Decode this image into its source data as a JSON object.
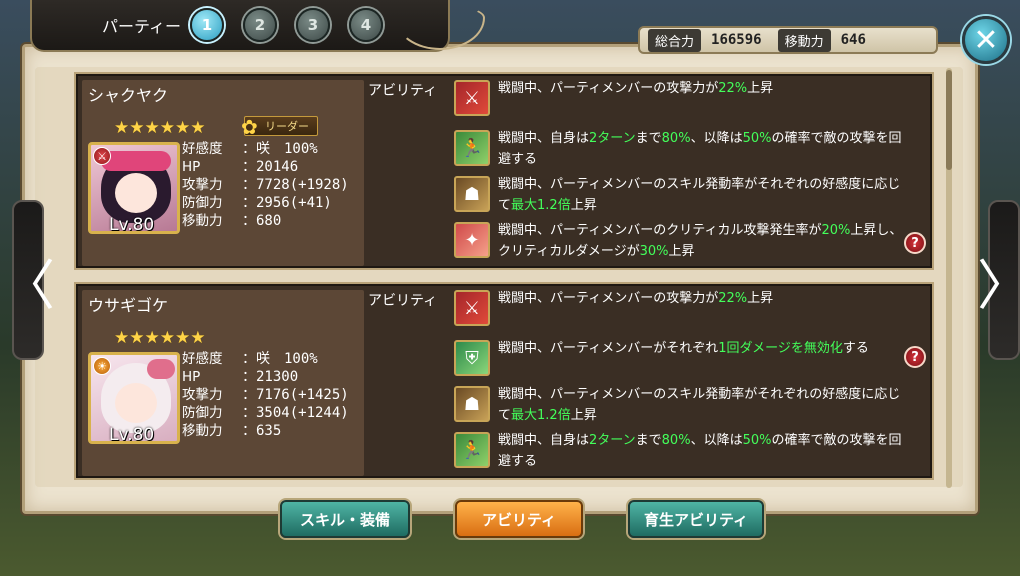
{
  "header": {
    "party_title": "パーティー",
    "party_tabs": [
      {
        "label": "1",
        "active": true
      },
      {
        "label": "2",
        "active": false
      },
      {
        "label": "3",
        "active": false
      },
      {
        "label": "4",
        "active": false
      }
    ],
    "total_power_label": "総合力",
    "total_power_value": "166596",
    "movement_label": "移動力",
    "movement_value": "646",
    "close_icon": "close-icon"
  },
  "nav": {
    "left_arrow": "〈",
    "right_arrow": "〉"
  },
  "ability_heading": "アビリティ",
  "members": [
    {
      "name": "シャクヤク",
      "stars": "★★★★★★",
      "leader_badge": "リーダー",
      "level": "Lv.80",
      "stats": [
        {
          "k": "好感度",
          "v": "：咲　100%"
        },
        {
          "k": "HP",
          "v": "：20146"
        },
        {
          "k": "攻撃力",
          "v": "：7728(+1928)"
        },
        {
          "k": "防御力",
          "v": "：2956(+41)"
        },
        {
          "k": "移動力",
          "v": "：680"
        }
      ],
      "abilities": [
        {
          "icon": "sword-icon",
          "parts": [
            "戦闘中、パーティメンバーの攻撃力が",
            "22%",
            "上昇"
          ]
        },
        {
          "icon": "dodge-icon",
          "parts": [
            "戦闘中、自身は",
            "2ターン",
            "まで",
            "80%",
            "、以降は",
            "50%",
            "の確率で敵の攻撃を回避する"
          ]
        },
        {
          "icon": "skill-icon",
          "parts": [
            "戦闘中、パーティメンバーのスキル発動率がそれぞれの好感度に応じて",
            "最大1.2倍",
            "上昇"
          ]
        },
        {
          "icon": "crit-icon",
          "parts": [
            "戦闘中、パーティメンバーのクリティカル攻撃発生率が",
            "20%",
            "上昇し、クリティカルダメージが",
            "30%",
            "上昇"
          ]
        }
      ]
    },
    {
      "name": "ウサギゴケ",
      "stars": "★★★★★★",
      "level": "Lv.80",
      "stats": [
        {
          "k": "好感度",
          "v": "：咲　100%"
        },
        {
          "k": "HP",
          "v": "：21300"
        },
        {
          "k": "攻撃力",
          "v": "：7176(+1425)"
        },
        {
          "k": "防御力",
          "v": "：3504(+1244)"
        },
        {
          "k": "移動力",
          "v": "：635"
        }
      ],
      "abilities": [
        {
          "icon": "sword-icon",
          "parts": [
            "戦闘中、パーティメンバーの攻撃力が",
            "22%",
            "上昇"
          ]
        },
        {
          "icon": "shield-icon",
          "parts": [
            "戦闘中、パーティメンバーがそれぞれ",
            "1回ダメージを無効化",
            "する"
          ]
        },
        {
          "icon": "skill-icon",
          "parts": [
            "戦闘中、パーティメンバーのスキル発動率がそれぞれの好感度に応じて",
            "最大1.2倍",
            "上昇"
          ]
        },
        {
          "icon": "dodge-icon",
          "parts": [
            "戦闘中、自身は",
            "2ターン",
            "まで",
            "80%",
            "、以降は",
            "50%",
            "の確率で敵の攻撃を回避する"
          ]
        }
      ]
    }
  ],
  "help_label": "?",
  "bottom_buttons": {
    "skill_equip": "スキル・装備",
    "ability": "アビリティ",
    "growth_ability": "育生アビリティ"
  },
  "colors": {
    "highlight_green": "#43ff5a",
    "frame_bg": "#ece3cf",
    "card_bg": "#3a2e24"
  }
}
